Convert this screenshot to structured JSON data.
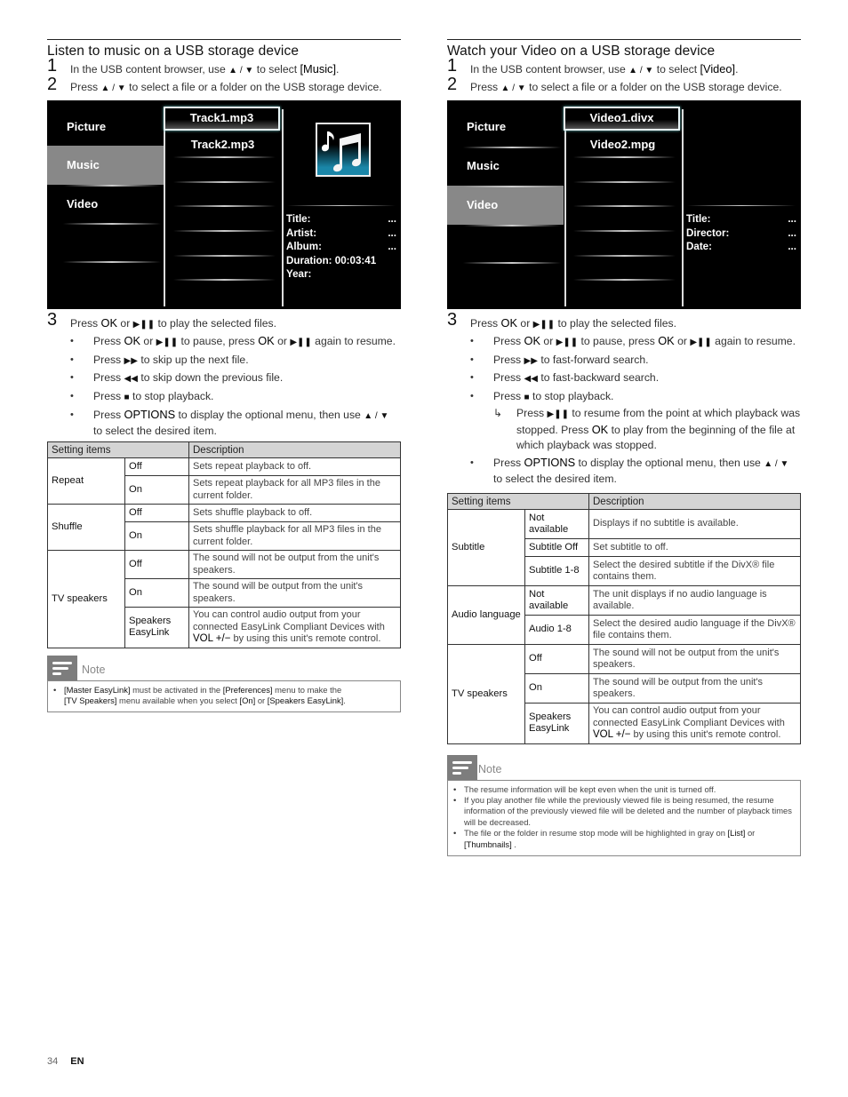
{
  "page": {
    "number": "34",
    "lang": "EN"
  },
  "music": {
    "title": "Listen to music on a USB storage device",
    "step1": {
      "num": "1",
      "pre": "In the USB content browser, use ",
      "sym": "▲ / ▼",
      "mid": " to select ",
      "bold": "[Music]",
      "post": "."
    },
    "step2": {
      "num": "2",
      "pre": "Press ",
      "sym": "▲ / ▼",
      "post": " to select a file or a folder on the USB storage device."
    },
    "screen": {
      "categories": [
        "Picture",
        "Music",
        "Video"
      ],
      "selected_category": "Music",
      "files": [
        "Track1.mp3",
        "Track2.mp3"
      ],
      "selected_file": "Track1.mp3",
      "icon": "music-notes-icon",
      "info": [
        {
          "label": "Title:",
          "value": "..."
        },
        {
          "label": "Artist:",
          "value": "..."
        },
        {
          "label": "Album:",
          "value": "..."
        },
        {
          "label": "Duration: 00:03:41",
          "value": ""
        },
        {
          "label": "Year:",
          "value": ""
        }
      ]
    },
    "step3": {
      "num": "3",
      "text": {
        "pre": "Press ",
        "ok": "OK",
        "or": " or ",
        "sym": "▶❚❚",
        "post": " to play the selected files."
      },
      "bullets": [
        {
          "a": "Press ",
          "b": "OK",
          "c": " or ",
          "s1": "▶❚❚",
          "d": " to pause, press ",
          "e": "OK",
          "f": " or ",
          "s2": "▶❚❚",
          "g": " again to resume."
        },
        {
          "a": "Press ",
          "s": "▶▶",
          "b": " to skip up the next file."
        },
        {
          "a": "Press ",
          "s": "◀◀",
          "b": " to skip down the previous file."
        },
        {
          "a": "Press ",
          "s": "■",
          "b": " to stop playback."
        },
        {
          "a": "Press ",
          "bold": "OPTIONS",
          "b": " to display the optional menu, then use ",
          "s": "▲ / ▼",
          "c": "to select the desired item."
        }
      ]
    },
    "table": {
      "headers": [
        "Setting items",
        "Description"
      ],
      "groups": [
        {
          "item": "Repeat",
          "rows": [
            {
              "opt": "Off",
              "desc": "Sets repeat playback to off."
            },
            {
              "opt": "On",
              "desc": "Sets repeat playback for all MP3 files in the current folder."
            }
          ]
        },
        {
          "item": "Shuffle",
          "rows": [
            {
              "opt": "Off",
              "desc": "Sets shuffle playback to off."
            },
            {
              "opt": "On",
              "desc": "Sets shuffle playback for all MP3 files in the current folder."
            }
          ]
        },
        {
          "item": "TV speakers",
          "rows": [
            {
              "opt": "Off",
              "desc": "The sound will not be output from the unit's speakers."
            },
            {
              "opt": "On",
              "desc": "The sound will be output from the unit's speakers."
            },
            {
              "opt": "Speakers EasyLink",
              "desc_pre": "You can control audio output from your connected EasyLink Compliant Devices with ",
              "desc_bold": "VOL +/−",
              "desc_post": " by using this unit's remote control."
            }
          ]
        }
      ]
    },
    "note": {
      "label": "Note",
      "items": [
        {
          "p1": "[Master EasyLink]",
          "t1": " must be activated in the ",
          "p2": "[Preferences]",
          "t2": " menu to make the ",
          "p3": "[TV Speakers]",
          "t3": " menu available when you select ",
          "p4": "[On]",
          "t4": " or ",
          "p5": "[Speakers EasyLink]",
          "t5": "."
        }
      ]
    }
  },
  "video": {
    "title": "Watch your Video on a USB storage device",
    "step1": {
      "num": "1",
      "pre": "In the USB content browser, use ",
      "sym": "▲ / ▼",
      "mid": " to select ",
      "bold": "[Video]",
      "post": "."
    },
    "step2": {
      "num": "2",
      "pre": "Press ",
      "sym": "▲ / ▼",
      "post": " to select a file or a folder on the USB storage device."
    },
    "screen": {
      "categories": [
        "Picture",
        "Music",
        "Video"
      ],
      "selected_category": "Video",
      "files": [
        "Video1.divx",
        "Video2.mpg"
      ],
      "selected_file": "Video1.divx",
      "info": [
        {
          "label": "Title:",
          "value": "..."
        },
        {
          "label": "Director:",
          "value": "..."
        },
        {
          "label": "Date:",
          "value": "..."
        }
      ]
    },
    "step3": {
      "num": "3",
      "text": {
        "pre": "Press ",
        "ok": "OK",
        "or": " or ",
        "sym": "▶❚❚",
        "post": " to play the selected files."
      },
      "bullets": [
        {
          "a": "Press ",
          "b": "OK",
          "c": " or ",
          "s1": "▶❚❚",
          "d": " to pause, press ",
          "e": "OK",
          "f": " or ",
          "s2": "▶❚❚",
          "g": " again to resume."
        },
        {
          "a": "Press ",
          "s": "▶▶",
          "b": " to fast-forward search."
        },
        {
          "a": "Press ",
          "s": "◀◀",
          "b": " to fast-backward search."
        },
        {
          "a": "Press ",
          "s": "■",
          "b": " to stop playback."
        }
      ],
      "arrow": {
        "a": "Press ",
        "s": "▶❚❚",
        "b": " to resume from the point at which playback was stopped. Press ",
        "ok": "OK",
        "c": " to play from the beginning of the file at which playback was stopped."
      },
      "options": {
        "a": "Press ",
        "bold": "OPTIONS",
        "b": " to display the optional menu, then use ",
        "s": "▲ / ▼",
        "c": "to select the desired item."
      }
    },
    "table": {
      "headers": [
        "Setting items",
        "Description"
      ],
      "groups": [
        {
          "item": "Subtitle",
          "rows": [
            {
              "opt": "Not available",
              "desc": "Displays if no subtitle is available."
            },
            {
              "opt": "Subtitle Off",
              "desc": "Set subtitle to off."
            },
            {
              "opt": "Subtitle 1-8",
              "desc": "Select the desired subtitle if the DivX® file contains them."
            }
          ]
        },
        {
          "item": "Audio language",
          "rows": [
            {
              "opt": "Not available",
              "desc": "The unit displays if no audio language is available."
            },
            {
              "opt": "Audio 1-8",
              "desc": "Select the desired audio language if the DivX® file contains them."
            }
          ]
        },
        {
          "item": "TV speakers",
          "rows": [
            {
              "opt": "Off",
              "desc": "The sound will not be output from the unit's speakers."
            },
            {
              "opt": "On",
              "desc": "The sound will be output from the unit's speakers."
            },
            {
              "opt": "Speakers EasyLink",
              "desc_pre": "You can control audio output from your connected EasyLink Compliant Devices with ",
              "desc_bold": "VOL +/−",
              "desc_post": " by using this unit's remote control."
            }
          ]
        }
      ]
    },
    "note": {
      "label": "Note",
      "items": [
        "The resume information will be kept even when the unit is turned off.",
        "If you play another file while the previously viewed file is being resumed, the resume information of the previously viewed file will be deleted and the number of playback times will be decreased."
      ],
      "item3": {
        "t1": "The file or the folder in resume stop mode will be highlighted in gray on ",
        "p1": "[List]",
        "t2": " or ",
        "p2": "[Thumbnails]",
        "t3": " ."
      }
    }
  }
}
